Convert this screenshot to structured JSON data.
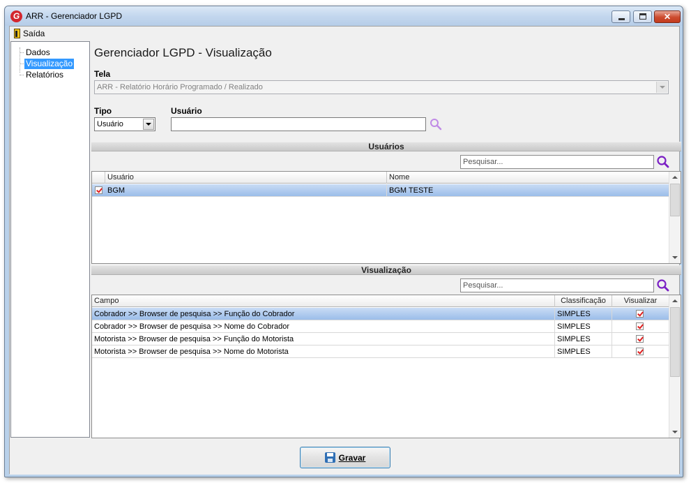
{
  "window": {
    "title": "ARR - Gerenciador LGPD",
    "logo_letter": "G"
  },
  "menu": {
    "exit_label": "Saída"
  },
  "sidebar": {
    "items": [
      {
        "label": "Dados",
        "selected": false
      },
      {
        "label": "Visualização",
        "selected": true
      },
      {
        "label": "Relatórios",
        "selected": false
      }
    ]
  },
  "main": {
    "title": "Gerenciador LGPD - Visualização",
    "tela_label": "Tela",
    "tela_value": "ARR - Relatório Horário Programado / Realizado",
    "tipo_label": "Tipo",
    "tipo_value": "Usuário",
    "usuario_label": "Usuário",
    "usuario_value": ""
  },
  "users_section": {
    "header": "Usuários",
    "search_placeholder": "Pesquisar...",
    "columns": [
      "Usuário",
      "Nome"
    ],
    "rows": [
      {
        "checked": true,
        "usuario": "BGM",
        "nome": "BGM TESTE",
        "selected": true
      }
    ]
  },
  "view_section": {
    "header": "Visualização",
    "search_placeholder": "Pesquisar...",
    "columns": [
      "Campo",
      "Classificação",
      "Visualizar"
    ],
    "rows": [
      {
        "campo": "Cobrador >> Browser de pesquisa >> Função do Cobrador",
        "classificacao": "SIMPLES",
        "visualizar": true,
        "selected": true
      },
      {
        "campo": "Cobrador >> Browser de pesquisa >> Nome do Cobrador",
        "classificacao": "SIMPLES",
        "visualizar": true,
        "selected": false
      },
      {
        "campo": "Motorista >> Browser de pesquisa >> Função do Motorista",
        "classificacao": "SIMPLES",
        "visualizar": true,
        "selected": false
      },
      {
        "campo": "Motorista >> Browser de pesquisa >> Nome do Motorista",
        "classificacao": "SIMPLES",
        "visualizar": true,
        "selected": false
      }
    ]
  },
  "footer": {
    "save_label": "Gravar"
  },
  "colors": {
    "selection_blue": "#3399ff",
    "row_highlight": "#9bbde9",
    "check_red": "#e02020",
    "search_icon": "#7a1fc4"
  }
}
